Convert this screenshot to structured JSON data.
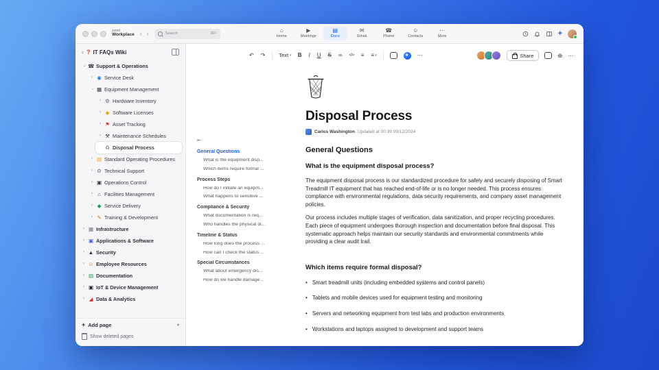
{
  "window": {
    "brand": {
      "top": "zoom",
      "bottom": "Workplace"
    },
    "search": {
      "placeholder": "Search",
      "shortcut": "⌘F"
    },
    "tabs": [
      {
        "label": "Home",
        "glyph": "⌂",
        "icon": "home-icon"
      },
      {
        "label": "Meetings",
        "glyph": "▶",
        "icon": "meetings-icon"
      },
      {
        "label": "Docs",
        "glyph": "▤",
        "icon": "docs-icon",
        "active": true
      },
      {
        "label": "Email",
        "glyph": "✉",
        "icon": "email-icon"
      },
      {
        "label": "Phone",
        "glyph": "☎",
        "icon": "phone-icon"
      },
      {
        "label": "Contacts",
        "glyph": "☺",
        "icon": "contacts-icon"
      },
      {
        "label": "More",
        "glyph": "⋯",
        "icon": "more-icon"
      }
    ]
  },
  "sidebar": {
    "title": "IT FAQs Wiki",
    "items": [
      {
        "label": "Support & Operations",
        "depth": 0,
        "state": "expanded",
        "glyph": "☎",
        "color": "#3a3a40",
        "icon": "phone-icon"
      },
      {
        "label": "Service Desk",
        "depth": 1,
        "state": "collapsed",
        "glyph": "◉",
        "color": "#1a73e8",
        "icon": "service-desk-icon"
      },
      {
        "label": "Equipment Management",
        "depth": 1,
        "state": "expanded",
        "glyph": "▦",
        "color": "#2f2f35",
        "icon": "equipment-icon"
      },
      {
        "label": "Hardware Inventory",
        "depth": 2,
        "state": "collapsed",
        "glyph": "⚙",
        "color": "#52607a",
        "icon": "hardware-icon"
      },
      {
        "label": "Software Licenses",
        "depth": 2,
        "state": "collapsed",
        "glyph": "◆",
        "color": "#f59e0b",
        "icon": "software-license-icon"
      },
      {
        "label": "Asset Tracking",
        "depth": 2,
        "state": "collapsed",
        "glyph": "⚑",
        "color": "#e0352b",
        "icon": "asset-pin-icon"
      },
      {
        "label": "Maintenance Schedules",
        "depth": 2,
        "state": "collapsed",
        "glyph": "⚒",
        "color": "#3a3a40",
        "icon": "maintenance-tools-icon"
      },
      {
        "label": "Disposal Process",
        "depth": 2,
        "state": "none",
        "selected": true,
        "glyph": "♻",
        "color": "#7a7a82",
        "icon": "trash-icon"
      },
      {
        "label": "Standard Operating Procedures",
        "depth": 1,
        "state": "collapsed",
        "glyph": "▤",
        "color": "#f59e0b",
        "icon": "procedures-book-icon"
      },
      {
        "label": "Technical Support",
        "depth": 1,
        "state": "collapsed",
        "glyph": "⚙",
        "color": "#6b7280",
        "icon": "technical-support-icon"
      },
      {
        "label": "Operations Control",
        "depth": 1,
        "state": "collapsed",
        "glyph": "▣",
        "color": "#2f2f35",
        "icon": "operations-icon"
      },
      {
        "label": "Facilities Management",
        "depth": 1,
        "state": "collapsed",
        "glyph": "⌂",
        "color": "#3a3a40",
        "icon": "facilities-icon"
      },
      {
        "label": "Service Delivery",
        "depth": 1,
        "state": "collapsed",
        "glyph": "◆",
        "color": "#16a34a",
        "icon": "delivery-icon"
      },
      {
        "label": "Training & Development",
        "depth": 1,
        "state": "collapsed",
        "glyph": "✎",
        "color": "#d97706",
        "icon": "training-icon"
      },
      {
        "label": "Infrastructure",
        "depth": 0,
        "state": "collapsed",
        "glyph": "▦",
        "color": "#6b7280",
        "icon": "infrastructure-icon"
      },
      {
        "label": "Applications & Software",
        "depth": 0,
        "state": "collapsed",
        "glyph": "▣",
        "color": "#2563eb",
        "icon": "applications-icon"
      },
      {
        "label": "Security",
        "depth": 0,
        "state": "collapsed",
        "glyph": "▲",
        "color": "#1f2937",
        "icon": "security-shield-icon"
      },
      {
        "label": "Employee Resources",
        "depth": 0,
        "state": "collapsed",
        "glyph": "☺",
        "color": "#d97706",
        "icon": "employee-icon"
      },
      {
        "label": "Documentation",
        "depth": 0,
        "state": "collapsed",
        "glyph": "▤",
        "color": "#16a34a",
        "icon": "documentation-icon"
      },
      {
        "label": "IoT & Device Management",
        "depth": 0,
        "state": "collapsed",
        "glyph": "▣",
        "color": "#17171c",
        "icon": "iot-device-icon"
      },
      {
        "label": "Data & Analytics",
        "depth": 0,
        "state": "collapsed",
        "glyph": "◢",
        "color": "#dc2626",
        "icon": "analytics-chart-icon"
      }
    ],
    "add_page": "Add page",
    "show_deleted": "Show deleted pages"
  },
  "toolbar": {
    "left": [
      {
        "name": "undo-icon",
        "glyph": "↶"
      },
      {
        "name": "redo-icon",
        "glyph": "↷"
      },
      {
        "name": "toolbar-divider",
        "cls": "tsep"
      },
      {
        "name": "text-style-dropdown",
        "glyph": "Text",
        "caret": "▾",
        "cls": "textbtn"
      },
      {
        "name": "bold-button",
        "glyph": "B",
        "cls": "fw"
      },
      {
        "name": "italic-button",
        "glyph": "I",
        "cls": "it"
      },
      {
        "name": "underline-button",
        "glyph": "U",
        "cls": "un"
      },
      {
        "name": "strikethrough-button",
        "glyph": "S",
        "cls": "st"
      },
      {
        "name": "link-icon",
        "glyph": "∞"
      },
      {
        "name": "code-icon",
        "glyph": "</>",
        "cls": "code"
      },
      {
        "name": "list-icon",
        "glyph": "≡"
      },
      {
        "name": "align-dropdown",
        "glyph": "≡",
        "caret": "▾"
      },
      {
        "name": "toolbar-divider",
        "cls": "tsep"
      },
      {
        "name": "comment-icon",
        "cls": "bubble-ic"
      },
      {
        "name": "ai-companion-icon",
        "glyph": "✶",
        "cls": "ai-dot"
      },
      {
        "name": "more-options-icon",
        "glyph": "⋯"
      }
    ],
    "collaborators": [
      {
        "bg": "linear-gradient(135deg,#f0a35e,#c97a2e)"
      },
      {
        "bg": "linear-gradient(135deg,#56b3ae,#2e837e)"
      },
      {
        "bg": "linear-gradient(135deg,#9a7fe0,#6a4fc0)"
      }
    ],
    "share_label": "Share",
    "right_more": "⋯",
    "globe_glyph": "⊕"
  },
  "toc": {
    "collapse_glyph": "⇤",
    "items": [
      {
        "label": "General Questions",
        "type": "section",
        "active": true
      },
      {
        "label": "What is the equipment disp...",
        "type": "item"
      },
      {
        "label": "Which items require formal ...",
        "type": "item"
      },
      {
        "label": "Process Steps",
        "type": "section"
      },
      {
        "label": "How do I initiate an equipm...",
        "type": "item"
      },
      {
        "label": "What happens to sensitive ...",
        "type": "item"
      },
      {
        "label": "Compliance & Security",
        "type": "section"
      },
      {
        "label": "What documentation is req...",
        "type": "item"
      },
      {
        "label": "Who handles the physical di...",
        "type": "item"
      },
      {
        "label": "Timeline & Status",
        "type": "section"
      },
      {
        "label": "How long does the process ...",
        "type": "item"
      },
      {
        "label": "How can I check the status ...",
        "type": "item"
      },
      {
        "label": "Special Circumstances",
        "type": "section"
      },
      {
        "label": "What about emergency dis...",
        "type": "item"
      },
      {
        "label": "How do we handle damage...",
        "type": "item"
      }
    ]
  },
  "doc": {
    "title": "Disposal Process",
    "author": "Carlos Washington",
    "updated": "Updated at 00:39 09/12/2024",
    "section_heading": "General Questions",
    "q1": {
      "heading": "What is the equipment disposal process?",
      "p1": "The equipment disposal process is our standardized procedure for safely and securely disposing of Smart Treadmill IT equipment that has reached end-of-life or is no longer needed. This process ensures compliance with environmental regulations, data security requirements, and company asset management policies.",
      "p2": "Our process includes multiple stages of verification, data sanitization, and proper recycling procedures. Each piece of equipment undergoes thorough inspection and documentation before final disposal. This systematic approach helps maintain our security standards and environmental commitments while providing a clear audit trail."
    },
    "q2": {
      "heading": "Which items require formal disposal?",
      "bullets": [
        "Smart treadmill units (including embedded systems and control panels)",
        "Tablets and mobile devices used for equipment testing and monitoring",
        "Servers and networking equipment from test labs and production environments",
        "Workstations and laptops assigned to development and support teams"
      ]
    }
  }
}
